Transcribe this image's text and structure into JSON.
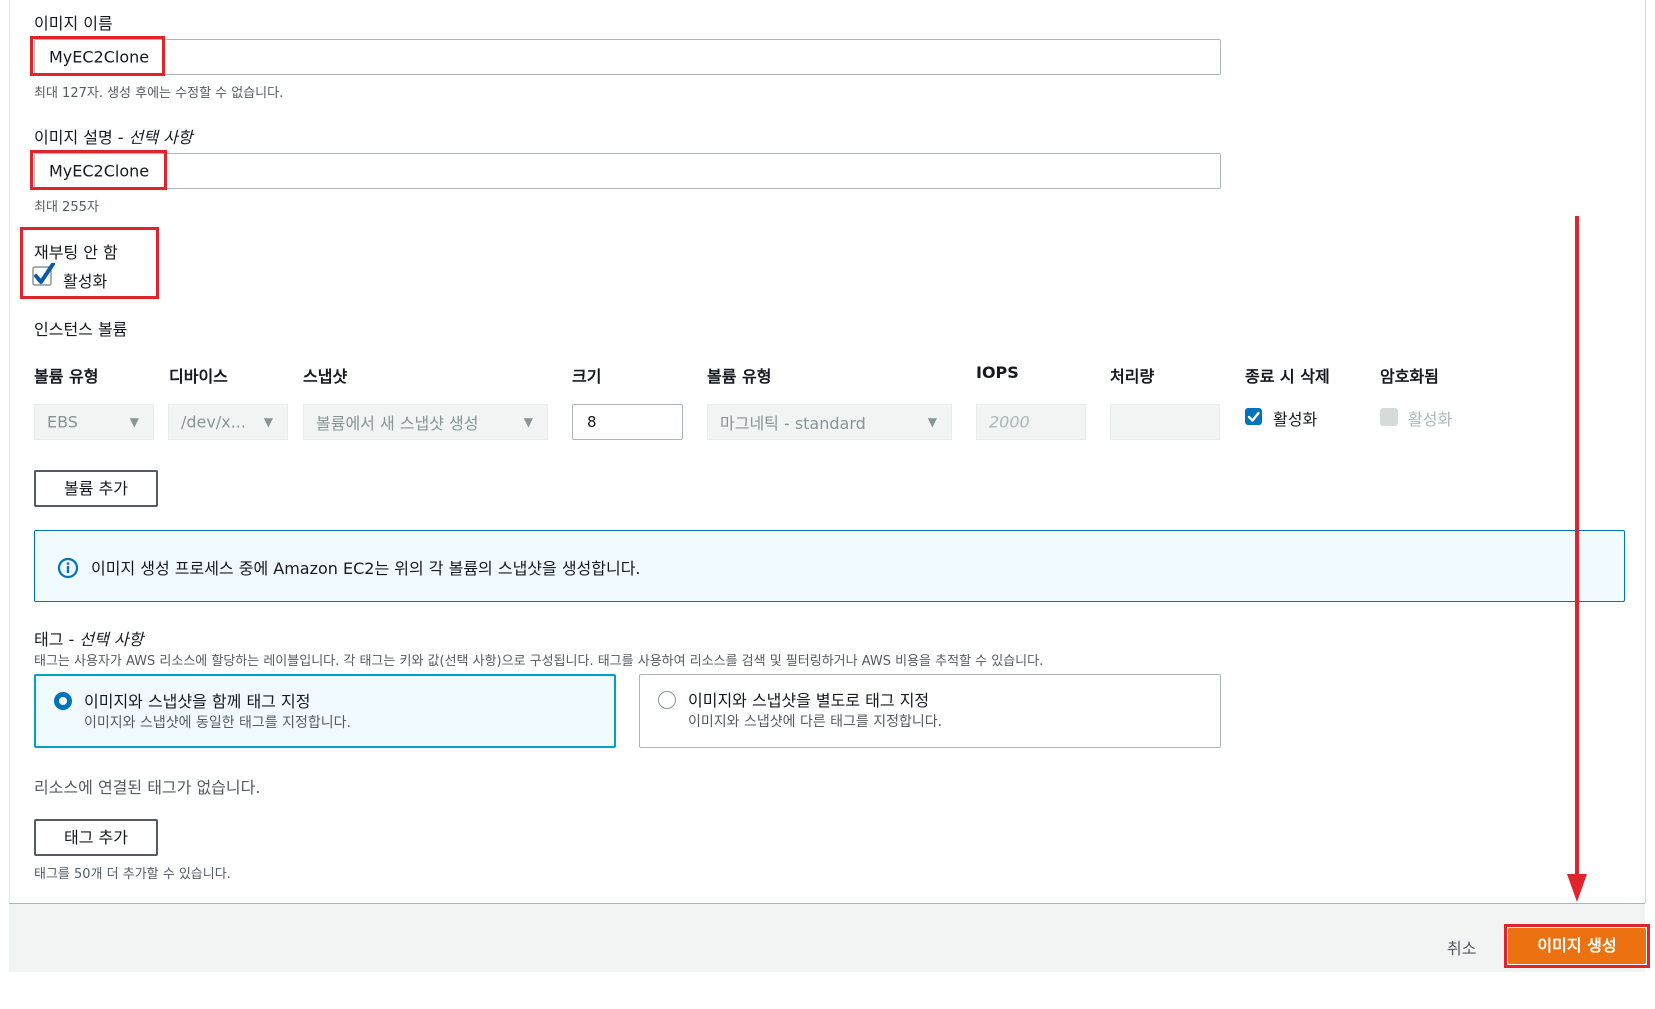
{
  "image_name": {
    "label": "이미지 이름",
    "value": "MyEC2Clone",
    "hint": "최대 127자. 생성 후에는 수정할 수 없습니다."
  },
  "image_description": {
    "label": "이미지 설명 - ",
    "label_optional": "선택 사항",
    "value": "MyEC2Clone",
    "hint": "최대 255자"
  },
  "no_reboot": {
    "label": "재부팅 안 함",
    "checkbox_label": "활성화",
    "checked": true
  },
  "volumes": {
    "title": "인스턴스 볼륨",
    "columns": [
      "볼륨 유형",
      "디바이스",
      "스냅샷",
      "크기",
      "볼륨 유형",
      "IOPS",
      "처리량",
      "종료 시 삭제",
      "암호화됨"
    ],
    "row": {
      "volume_type": "EBS",
      "device": "/dev/x...",
      "snapshot": "볼륨에서 새 스냅샷 생성",
      "size": "8",
      "ebs_type": "마그네틱 - standard",
      "iops": "2000",
      "throughput": "",
      "delete_on_termination": "활성화",
      "encrypted": "활성화"
    },
    "add_button": "볼륨 추가"
  },
  "info": {
    "text": "이미지 생성 프로세스 중에 Amazon EC2는 위의 각 볼륨의 스냅샷을 생성합니다."
  },
  "tags": {
    "label": "태그 - ",
    "label_optional": "선택 사항",
    "description": "태그는 사용자가 AWS 리소스에 할당하는 레이블입니다. 각 태그는 키와 값(선택 사항)으로 구성됩니다. 태그를 사용하여 리소스를 검색 및 필터링하거나 AWS 비용을 추적할 수 있습니다.",
    "options": [
      {
        "title": "이미지와 스냅샷을 함께 태그 지정",
        "desc": "이미지와 스냅샷에 동일한 태그를 지정합니다.",
        "selected": true
      },
      {
        "title": "이미지와 스냅샷을 별도로 태그 지정",
        "desc": "이미지와 스냅샷에 다른 태그를 지정합니다.",
        "selected": false
      }
    ],
    "empty_text": "리소스에 연결된 태그가 없습니다.",
    "add_button": "태그 추가",
    "remaining_hint": "태그를 50개 더 추가할 수 있습니다."
  },
  "footer": {
    "cancel": "취소",
    "create": "이미지 생성"
  },
  "colors": {
    "primary": "#ec7211",
    "accent": "#0073bb",
    "annotation": "#e0242c"
  }
}
